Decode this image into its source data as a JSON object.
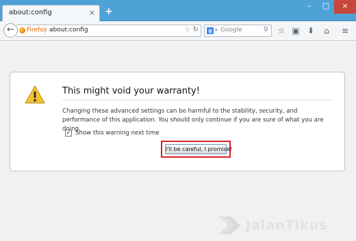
{
  "tab": {
    "title": "about:config",
    "close_glyph": "×"
  },
  "newtab_glyph": "+",
  "window_controls": {
    "minimize": "–",
    "maximize": "□",
    "close": "×"
  },
  "urlbar": {
    "identity_label": "Firefox",
    "url": "about:config"
  },
  "searchbar": {
    "engine_letter": "g",
    "placeholder": "Google"
  },
  "warning": {
    "title": "This might void your warranty!",
    "description": "Changing these advanced settings can be harmful to the stability, security, and performance of this application. You should only continue if you are sure of what you are doing.",
    "checkbox_label": "Show this warning next time",
    "checkbox_checked": true,
    "button_label": "I'll be careful, I promise!"
  },
  "highlight_color": "#d81f1f",
  "accent_color": "#4fa2d6",
  "icons": [
    "back-icon",
    "firefox-icon",
    "dropdown-icon",
    "reload-icon",
    "search-engine-icon",
    "search-icon",
    "bookmark-star-icon",
    "reading-list-icon",
    "download-icon",
    "home-icon",
    "menu-icon",
    "warning-icon"
  ],
  "watermark": "JalanTikus"
}
